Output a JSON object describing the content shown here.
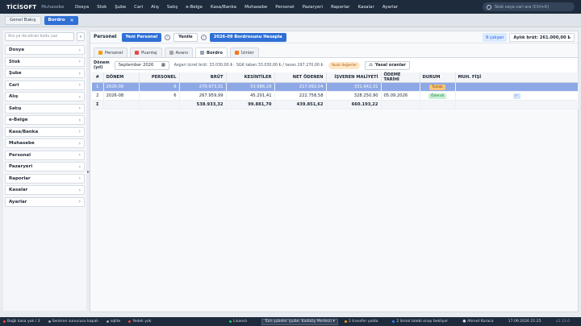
{
  "app": {
    "logo": "TİCİSOFT",
    "module": "Muhasebe"
  },
  "menu": [
    "Dosya",
    "Stok",
    "Şube",
    "Cari",
    "Alış",
    "Satış",
    "e-Belge",
    "Kasa/Banka",
    "Muhasebe",
    "Personel",
    "Pazaryeri",
    "Raporlar",
    "Kasalar",
    "Ayarlar"
  ],
  "search": {
    "placeholder": "Stok veya cari ara (Ctrl+K)"
  },
  "tabs": [
    {
      "label": "Genel Bakış"
    },
    {
      "label": "Bordro",
      "close": "✕"
    }
  ],
  "sidebar": {
    "search_placeholder": "Ara ya da ekran kodu yaz",
    "collapse": "«",
    "items": [
      "Dosya",
      "Stok",
      "Şube",
      "Cari",
      "Alış",
      "Satış",
      "e-Belge",
      "Kasa/Banka",
      "Muhasebe",
      "Personel",
      "Pazaryeri",
      "Raporlar",
      "Kasalar",
      "Ayarlar"
    ],
    "chevron": "›"
  },
  "header": {
    "title": "Personel",
    "new_button": "Yeni Personel",
    "refresh_button": "Yenile",
    "calc_button": "2026-09 Bordrosunu Hesapla",
    "count_badge": "6 çalışan",
    "total": "Aylık brüt: 261.000,00 ₺",
    "info": "i"
  },
  "subtabs": [
    "Personel",
    "Puantaj",
    "Avans",
    "Bordro",
    "İzinler"
  ],
  "filter": {
    "label_line1": "Dönem",
    "label_line2": "(yıl)",
    "period_value": "September 2026",
    "note": "Asgari ücret brüt: 33.030,00 ₺ · SGK taban 33.030,00 ₺ / tavan 297.270,00 ₺",
    "pill": "Yasal değerler",
    "rates_button": "Yasal oranlar"
  },
  "table": {
    "columns": [
      "#",
      "DÖNEM",
      "PERSONEL",
      "BRÜT",
      "KESİNTİLER",
      "NET ÖDENEN",
      "İŞVEREN MALİYETİ",
      "ÖDEME TARİHİ",
      "DURUM",
      "MUH. FİŞİ"
    ],
    "rows": [
      {
        "no": "1",
        "period": "2026-09",
        "personnel": "6",
        "gross": "270.973,31",
        "deductions": "53.686,29",
        "net": "217.092,04",
        "employer": "331.942,31",
        "pay_date": "",
        "status": "Taslak",
        "voucher": ""
      },
      {
        "no": "2",
        "period": "2026-08",
        "personnel": "6",
        "gross": "267.959,99",
        "deductions": "45.201,41",
        "net": "222.758,58",
        "employer": "328.250,90",
        "pay_date": "05.09.2026",
        "status": "Ödendi",
        "voucher": "✓"
      }
    ],
    "total": {
      "label": "Σ",
      "gross": "538.933,32",
      "deductions": "99.881,70",
      "net": "439.851,62",
      "employer": "660.193,22"
    }
  },
  "statusbar": {
    "left": [
      "Bağlı kasa yok / 3",
      "Senkron sunucusu kapalı",
      "sqlite",
      "Yedek yok"
    ],
    "license": "Lisanslı",
    "branch": "Tüm şubeler (şube: Kadıköy Merkez)",
    "transfers": "1 transfer yolda",
    "approvals": "2 ikmal talebi onay bekliyor",
    "user": "Ahmet Karaca",
    "datetime": "17.09.2026 21:25",
    "version": "v2.13.0"
  }
}
